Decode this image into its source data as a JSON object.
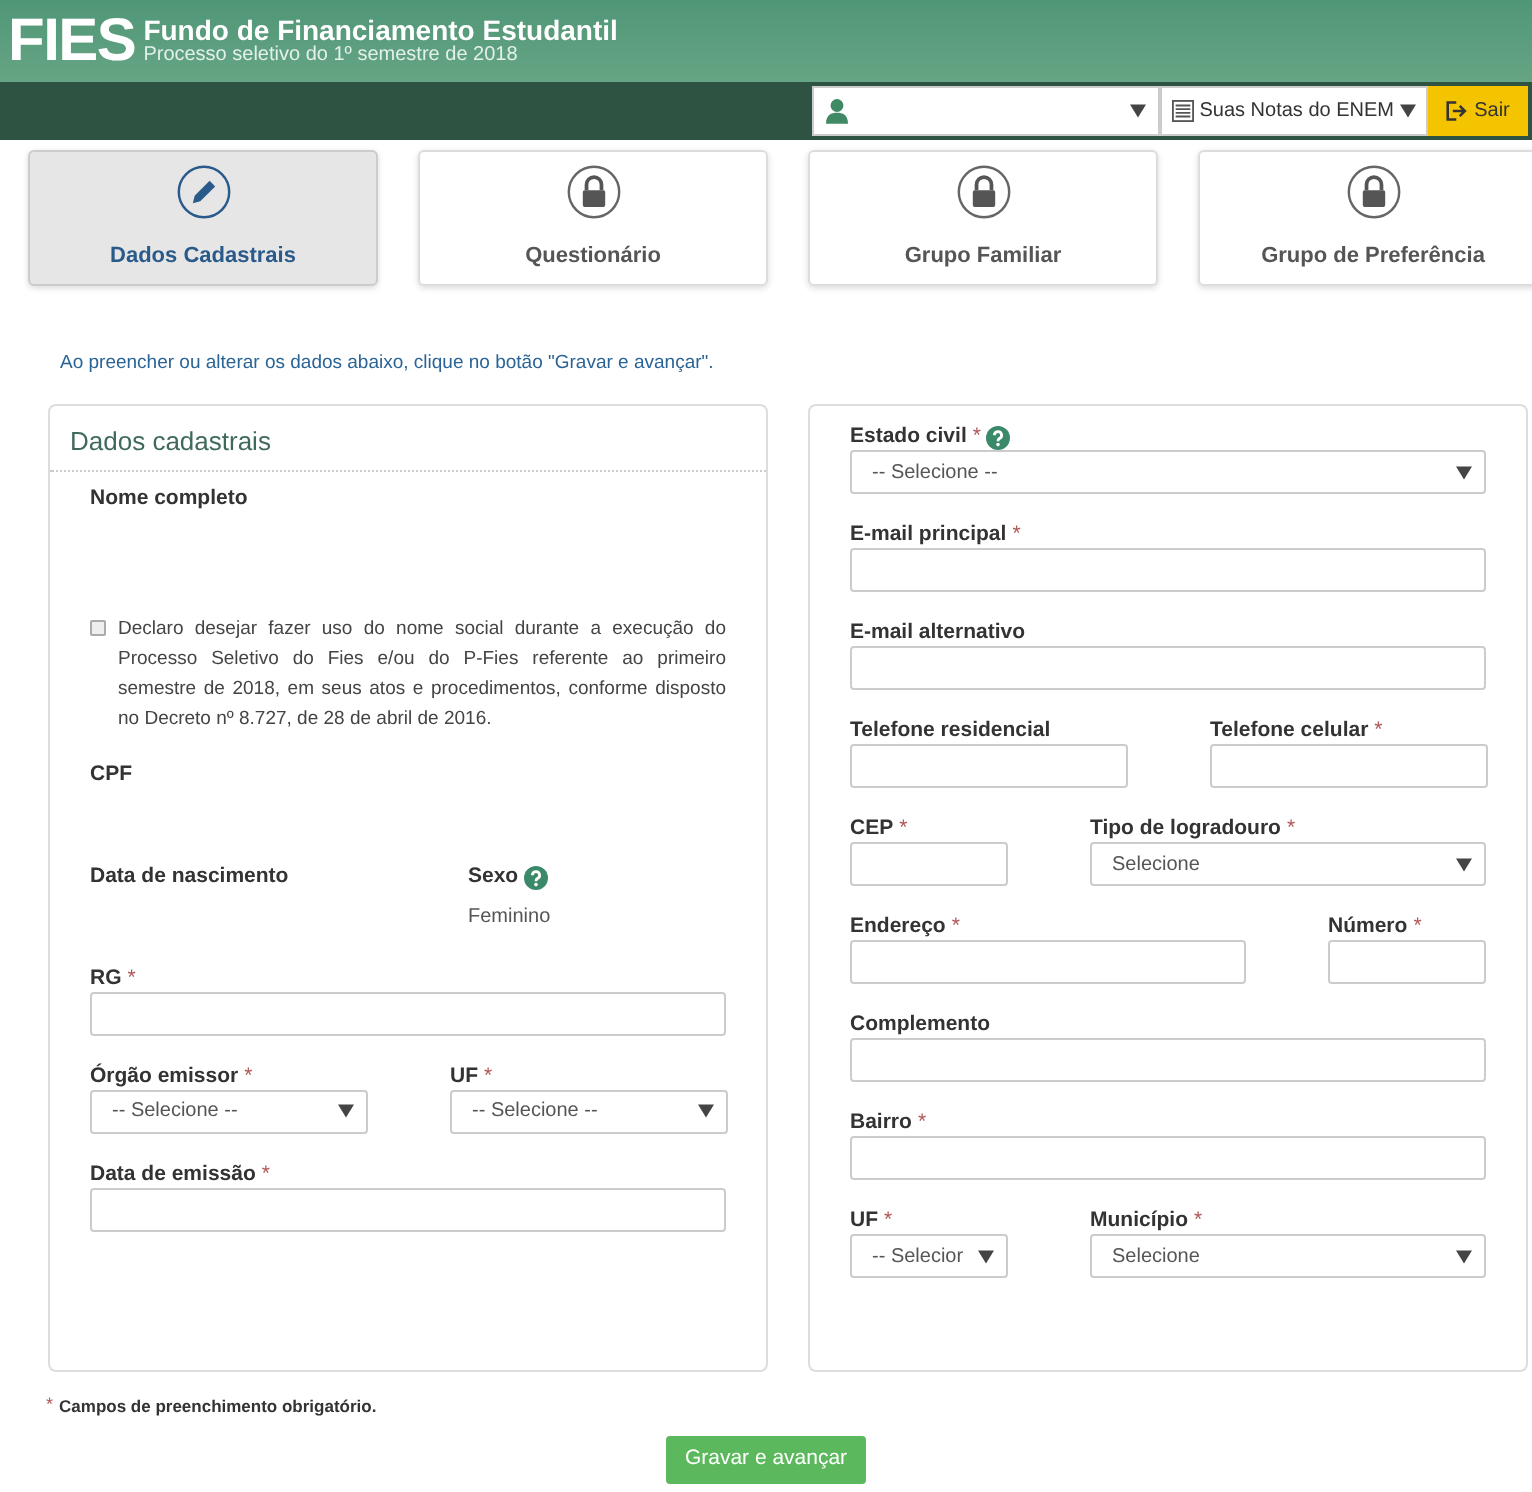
{
  "header": {
    "logo": "FIES",
    "title": "Fundo de Financiamento Estudantil",
    "subtitle": "Processo seletivo do 1º semestre de 2018"
  },
  "topbar": {
    "notes_menu": {
      "label": "Suas Notas do ENEM"
    },
    "logout": {
      "label": "Sair"
    }
  },
  "tabs": [
    {
      "label": "Dados Cadastrais",
      "selected": true,
      "kind": "pencil"
    },
    {
      "label": "Questionário",
      "selected": false,
      "kind": "lock"
    },
    {
      "label": "Grupo Familiar",
      "selected": false,
      "kind": "lock"
    },
    {
      "label": "Grupo de Preferência",
      "selected": false,
      "kind": "lock"
    }
  ],
  "info": "Ao preencher ou alterar os dados abaixo, clique no botão \"Gravar e avançar\".",
  "left_panel": {
    "title": "Dados cadastrais",
    "rows": [
      [
        {
          "kind": "static",
          "label": "Nome completo"
        }
      ],
      [
        {
          "kind": "checkbox",
          "checked": false,
          "text": "Declaro desejar fazer uso do nome social durante a execução do Processo Seletivo do Fies e/ou do P-Fies referente ao primeiro semestre de 2018, em seus atos e procedimentos, conforme disposto no Decreto nº 8.727, de 28 de abril de 2016."
        }
      ],
      [
        {
          "kind": "static",
          "label": "CPF"
        }
      ],
      [
        {
          "kind": "static",
          "label": "Data de nascimento"
        },
        {
          "kind": "static",
          "label": "Sexo",
          "help": true,
          "value": "Feminino"
        }
      ],
      [
        {
          "kind": "text",
          "label": "RG",
          "mark": "*"
        }
      ],
      [
        {
          "kind": "select",
          "label": "Órgão emissor",
          "mark": "*",
          "value": "-- Selecione --"
        },
        {
          "kind": "select",
          "label": "UF",
          "mark": "*",
          "value": "-- Selecione --"
        }
      ],
      [
        {
          "kind": "text",
          "label": "Data de emissão",
          "mark": "*"
        }
      ]
    ]
  },
  "right_panel": {
    "rows": [
      [
        {
          "kind": "select",
          "label": "Estado civil",
          "mark": "*",
          "help": true,
          "value": "-- Selecione --"
        }
      ],
      [
        {
          "kind": "text",
          "label": "E-mail principal",
          "mark": "*"
        }
      ],
      [
        {
          "kind": "text",
          "label": "E-mail alternativo"
        }
      ],
      [
        {
          "kind": "text",
          "label": "Telefone residencial"
        },
        {
          "kind": "text",
          "label": "Telefone celular",
          "mark": "*"
        }
      ],
      [
        {
          "kind": "text",
          "label": "CEP",
          "mark": "*"
        },
        {
          "kind": "select",
          "label": "Tipo de logradouro",
          "mark": "*",
          "value": "Selecione"
        }
      ],
      [
        {
          "kind": "text",
          "label": "Endereço",
          "mark": "*"
        },
        {
          "kind": "text",
          "label": "Número",
          "mark": "*"
        }
      ],
      [
        {
          "kind": "text",
          "label": "Complemento"
        }
      ],
      [
        {
          "kind": "text",
          "label": "Bairro",
          "mark": "*"
        }
      ],
      [
        {
          "kind": "select",
          "label": "UF",
          "mark": "*",
          "value": "-- Selecior"
        },
        {
          "kind": "select",
          "label": "Município",
          "mark": "*",
          "value": "Selecione"
        }
      ]
    ]
  },
  "footer": {
    "mark": "*",
    "note": "Campos de preenchimento obrigatório.",
    "button": "Gravar e avançar"
  }
}
